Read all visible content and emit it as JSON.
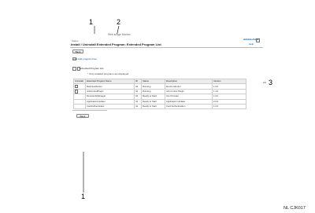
{
  "callouts": {
    "top_left": "1",
    "top_mid": "2",
    "right": "3",
    "bottom": "1"
  },
  "figure_code": "NL CJK017",
  "window": {
    "title": "Web Image Monitor",
    "header_links": "Administrator",
    "breadcrumb": "Status",
    "page_title": "Install / Uninstall Extended Program: Extended Program List",
    "help_link": "Help"
  },
  "toolbar": {
    "back_label": "Back",
    "add_label": "Add",
    "add_hint": "Add program from"
  },
  "list": {
    "caption": "Extended Program List",
    "note": "* Only installed programs are displayed",
    "columns": [
      "Uninstall",
      "Extended Program Name",
      "ID",
      "Status",
      "Description",
      "Version"
    ],
    "rows": [
      [
        "",
        "MachineMonitor",
        "44",
        "Running",
        "Device Monitor",
        "1.0.0"
      ],
      [
        "",
        "JobControlPlugin",
        "44",
        "Running",
        "Job Control Plugin",
        "1.1.0"
      ],
      [
        "",
        "DeviceInfoManager",
        "44",
        "Ready to Start",
        "Info Provider",
        "1.0.0"
      ],
      [
        "",
        "ApplicationUpdater",
        "44",
        "Ready to Start",
        "Application Updater",
        "2.0.0"
      ],
      [
        "",
        "CardAuthenticator",
        "44",
        "Ready to Start",
        "Card Authentication",
        "1.0.0"
      ]
    ]
  },
  "footer": {
    "back_label": "Back"
  }
}
